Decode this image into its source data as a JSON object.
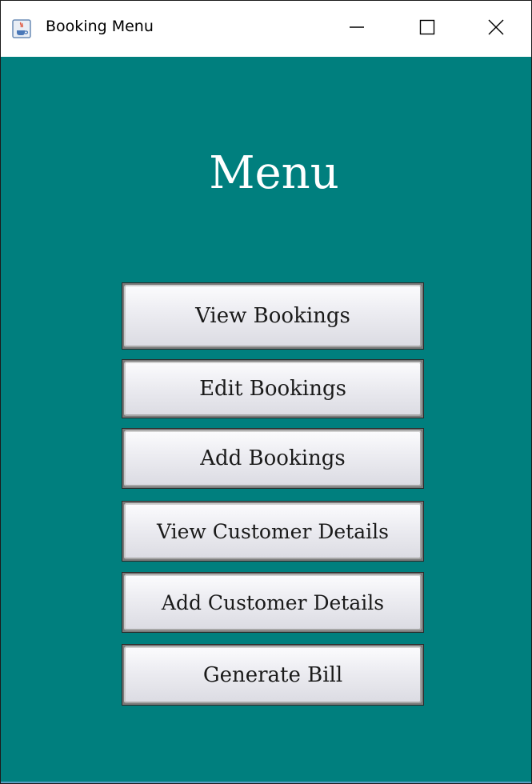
{
  "window": {
    "title": "Booking Menu",
    "app_icon": "java-cup-icon",
    "controls": {
      "minimize_icon": "minimize-icon",
      "maximize_icon": "maximize-icon",
      "close_icon": "close-icon"
    }
  },
  "main": {
    "heading": "Menu",
    "buttons": [
      {
        "label": "View Bookings"
      },
      {
        "label": "Edit Bookings"
      },
      {
        "label": "Add Bookings"
      },
      {
        "label": "View Customer Details"
      },
      {
        "label": "Add Customer Details"
      },
      {
        "label": "Generate Bill"
      }
    ]
  },
  "colors": {
    "background": "#007f7e",
    "heading_text": "#ffffff",
    "button_text": "#1a1a1a",
    "titlebar": "#ffffff"
  }
}
